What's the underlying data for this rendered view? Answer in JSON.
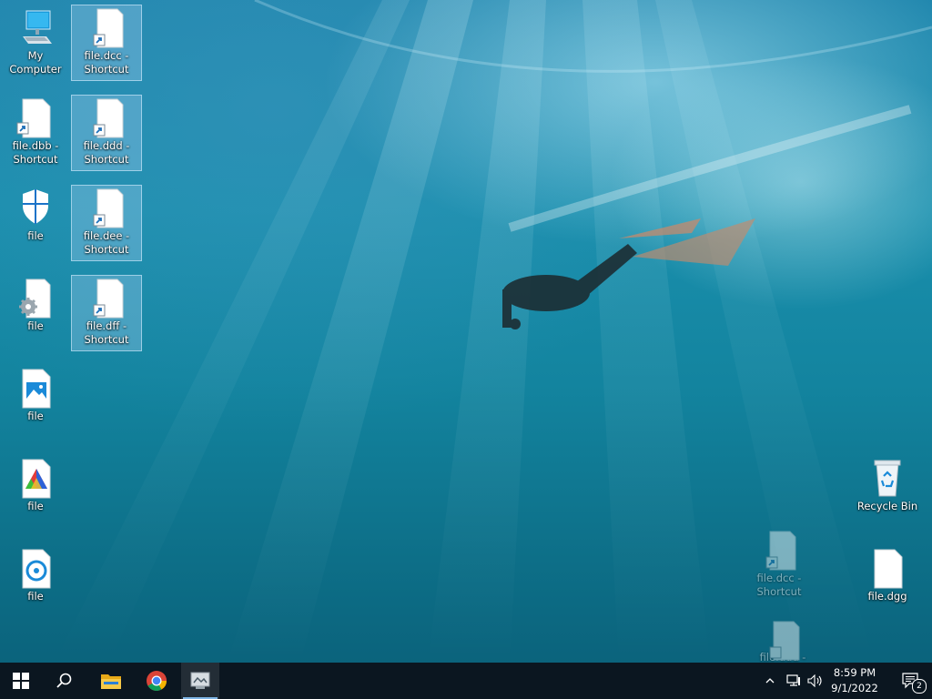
{
  "desktop": {
    "icons": [
      {
        "label": "My Computer",
        "type": "computer"
      },
      {
        "label": "file.dcc - Shortcut",
        "type": "shortcut"
      },
      {
        "label": "file.dbb - Shortcut",
        "type": "shortcut"
      },
      {
        "label": "file.ddd - Shortcut",
        "type": "shortcut"
      },
      {
        "label": "file",
        "type": "shield"
      },
      {
        "label": "file.dee - Shortcut",
        "type": "shortcut"
      },
      {
        "label": "file",
        "type": "settings-file"
      },
      {
        "label": "file.dff - Shortcut",
        "type": "shortcut"
      },
      {
        "label": "file",
        "type": "image-file"
      },
      {
        "label": "file",
        "type": "color-file"
      },
      {
        "label": "file",
        "type": "media-file"
      },
      {
        "label": "Recycle Bin",
        "type": "recycle-bin"
      },
      {
        "label": "file.dgg",
        "type": "blank-file"
      },
      {
        "label": "file.dcc - Shortcut",
        "type": "shortcut-drag"
      },
      {
        "label": "file.ddd - Shortcut",
        "type": "shortcut-drag"
      }
    ]
  },
  "taskbar": {
    "buttons": [
      "start-icon",
      "search-icon",
      "file-explorer-icon",
      "chrome-icon",
      "app-window-icon"
    ],
    "tray": {
      "time": "8:59 PM",
      "date": "9/1/2022",
      "notification_count": "2"
    }
  }
}
